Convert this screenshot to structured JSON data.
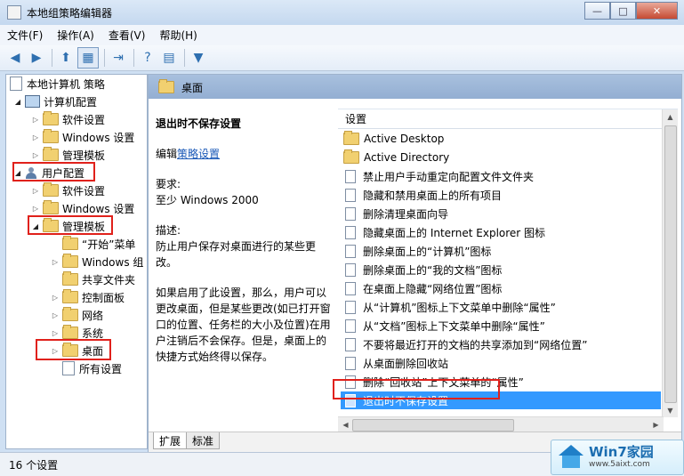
{
  "window": {
    "title": "本地组策略编辑器",
    "btn_min": "—",
    "btn_max": "□",
    "btn_close": "✕"
  },
  "menu": [
    "文件(F)",
    "操作(A)",
    "查看(V)",
    "帮助(H)"
  ],
  "toolbar": {
    "back": "◀",
    "forward": "▶",
    "up": "⬆",
    "show_hide": "▦",
    "export": "⇥",
    "help": "?",
    "properties": "▤",
    "filter": "▼"
  },
  "tree": [
    {
      "label": "本地计算机 策略",
      "icon": "doc-icon",
      "arrow": ""
    },
    {
      "label": "计算机配置",
      "icon": "computer-icon",
      "arrow": "◢"
    },
    {
      "label": "软件设置",
      "icon": "folder-icon",
      "arrow": "▷"
    },
    {
      "label": "Windows 设置",
      "icon": "folder-icon",
      "arrow": "▷"
    },
    {
      "label": "管理模板",
      "icon": "folder-icon",
      "arrow": "▷"
    },
    {
      "label": "用户配置",
      "icon": "user-icon",
      "arrow": "◢"
    },
    {
      "label": "软件设置",
      "icon": "folder-icon",
      "arrow": "▷"
    },
    {
      "label": "Windows 设置",
      "icon": "folder-icon",
      "arrow": "▷"
    },
    {
      "label": "管理模板",
      "icon": "folder-icon",
      "arrow": "◢"
    },
    {
      "label": "“开始”菜单",
      "icon": "folder-icon",
      "arrow": ""
    },
    {
      "label": "Windows 组",
      "icon": "folder-icon",
      "arrow": "▷"
    },
    {
      "label": "共享文件夹",
      "icon": "folder-icon",
      "arrow": ""
    },
    {
      "label": "控制面板",
      "icon": "folder-icon",
      "arrow": "▷"
    },
    {
      "label": "网络",
      "icon": "folder-icon",
      "arrow": "▷"
    },
    {
      "label": "系统",
      "icon": "folder-icon",
      "arrow": "▷"
    },
    {
      "label": "桌面",
      "icon": "folder-icon",
      "arrow": "▷"
    },
    {
      "label": "所有设置",
      "icon": "settings-icon",
      "arrow": ""
    }
  ],
  "right": {
    "header": "桌面",
    "desc_title": "退出时不保存设置",
    "edit_prefix": "编辑",
    "edit_link": "策略设置",
    "req_label": "要求:",
    "req_value": "至少 Windows 2000",
    "desc_label": "描述:",
    "desc_text": "防止用户保存对桌面进行的某些更改。",
    "desc_text2": "如果启用了此设置，那么，用户可以更改桌面，但是某些更改(如已打开窗口的位置、任务栏的大小及位置)在用户注销后不会保存。但是，桌面上的快捷方式始终得以保存。",
    "column": "设置",
    "items": [
      {
        "label": "Active Desktop",
        "type": "folder"
      },
      {
        "label": "Active Directory",
        "type": "folder"
      },
      {
        "label": "禁止用户手动重定向配置文件文件夹",
        "type": "setting"
      },
      {
        "label": "隐藏和禁用桌面上的所有项目",
        "type": "setting"
      },
      {
        "label": "删除清理桌面向导",
        "type": "setting"
      },
      {
        "label": "隐藏桌面上的 Internet Explorer 图标",
        "type": "setting"
      },
      {
        "label": "删除桌面上的“计算机”图标",
        "type": "setting"
      },
      {
        "label": "删除桌面上的“我的文档”图标",
        "type": "setting"
      },
      {
        "label": "在桌面上隐藏“网络位置”图标",
        "type": "setting"
      },
      {
        "label": "从“计算机”图标上下文菜单中删除“属性”",
        "type": "setting"
      },
      {
        "label": "从“文档”图标上下文菜单中删除“属性”",
        "type": "setting"
      },
      {
        "label": "不要将最近打开的文档的共享添加到“网络位置”",
        "type": "setting"
      },
      {
        "label": "从桌面删除回收站",
        "type": "setting"
      },
      {
        "label": "删除“回收站”上下文菜单的“属性”",
        "type": "setting"
      },
      {
        "label": "退出时不保存设置",
        "type": "setting",
        "selected": true
      }
    ],
    "tabs": [
      "扩展",
      "标准"
    ]
  },
  "status": "16 个设置",
  "watermark": {
    "name": "Win7家园",
    "url": "www.5aixt.com"
  },
  "colors": {
    "selection": "#3399ff",
    "highlight_box": "#e0211b",
    "header_band": "#a8c0de"
  }
}
